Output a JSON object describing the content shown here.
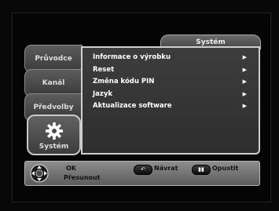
{
  "sidebar": {
    "items": [
      {
        "label": "Průvodce"
      },
      {
        "label": "Kanál"
      },
      {
        "label": "Předvolby"
      },
      {
        "label": "Systém",
        "icon": "gear-icon"
      }
    ]
  },
  "panel": {
    "title": "Systém",
    "items": [
      {
        "label": "Informace o výrobku",
        "arrow": "▶"
      },
      {
        "label": "Reset",
        "arrow": "▶"
      },
      {
        "label": "Změna kódu PIN",
        "arrow": "▶"
      },
      {
        "label": "Jazyk",
        "arrow": "▶"
      },
      {
        "label": "Aktualizace software",
        "arrow": "▶"
      }
    ]
  },
  "footer": {
    "ok_label": "OK",
    "move_label": "Přesunout",
    "back_label": "Návrat",
    "exit_label": "Opustit",
    "back_key_glyph": "↶",
    "exit_key_glyph": "▮▮"
  },
  "colors": {
    "panel_background": "#363636",
    "border": "#cfcfcf",
    "text": "#ffffff"
  }
}
